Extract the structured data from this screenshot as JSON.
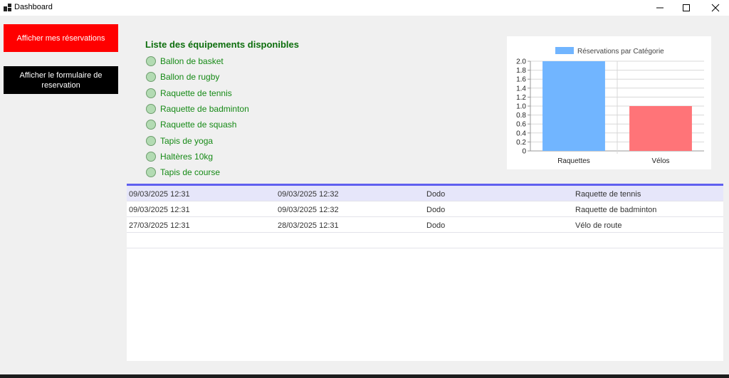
{
  "window": {
    "title": "Dashboard",
    "minimize_icon": "minimize-icon",
    "maximize_icon": "maximize-icon",
    "close_icon": "close-icon"
  },
  "buttons": {
    "reservations": {
      "label": "Afficher mes réservations",
      "color": "#ff0000"
    },
    "form": {
      "label": "Afficher le formulaire de reservation",
      "color": "#000000"
    }
  },
  "equipment": {
    "title": "Liste des équipements disponibles",
    "items": [
      "Ballon de basket",
      "Ballon de rugby",
      "Raquette de tennis",
      "Raquette de badminton",
      "Raquette de squash",
      "Tapis de yoga",
      "Haltères 10kg",
      "Tapis de course"
    ]
  },
  "chart_data": {
    "type": "bar",
    "categories": [
      "Raquettes",
      "Vélos"
    ],
    "values": [
      2,
      1
    ],
    "bar_colors": [
      "#71b5ff",
      "#ff7478"
    ],
    "legend": "Réservations par Catégorie",
    "legend_placement": "top-center",
    "ylim": [
      0,
      2
    ],
    "ytick_step": 0.2,
    "y_ticks": [
      "0",
      "0.2",
      "0.4",
      "0.6",
      "0.8",
      "1.0",
      "1.2",
      "1.4",
      "1.6",
      "1.8",
      "2.0"
    ],
    "grid": true
  },
  "reservations_grid": {
    "accent_color": "#6060ef",
    "rows": [
      {
        "start": "09/03/2025 12:31",
        "end": "09/03/2025 12:32",
        "user": "Dodo",
        "equipment": "Raquette de tennis",
        "selected": true
      },
      {
        "start": "09/03/2025 12:31",
        "end": "09/03/2025 12:32",
        "user": "Dodo",
        "equipment": "Raquette de badminton",
        "selected": false
      },
      {
        "start": "27/03/2025 12:31",
        "end": "28/03/2025 12:31",
        "user": "Dodo",
        "equipment": "Vélo de route",
        "selected": false
      }
    ]
  }
}
